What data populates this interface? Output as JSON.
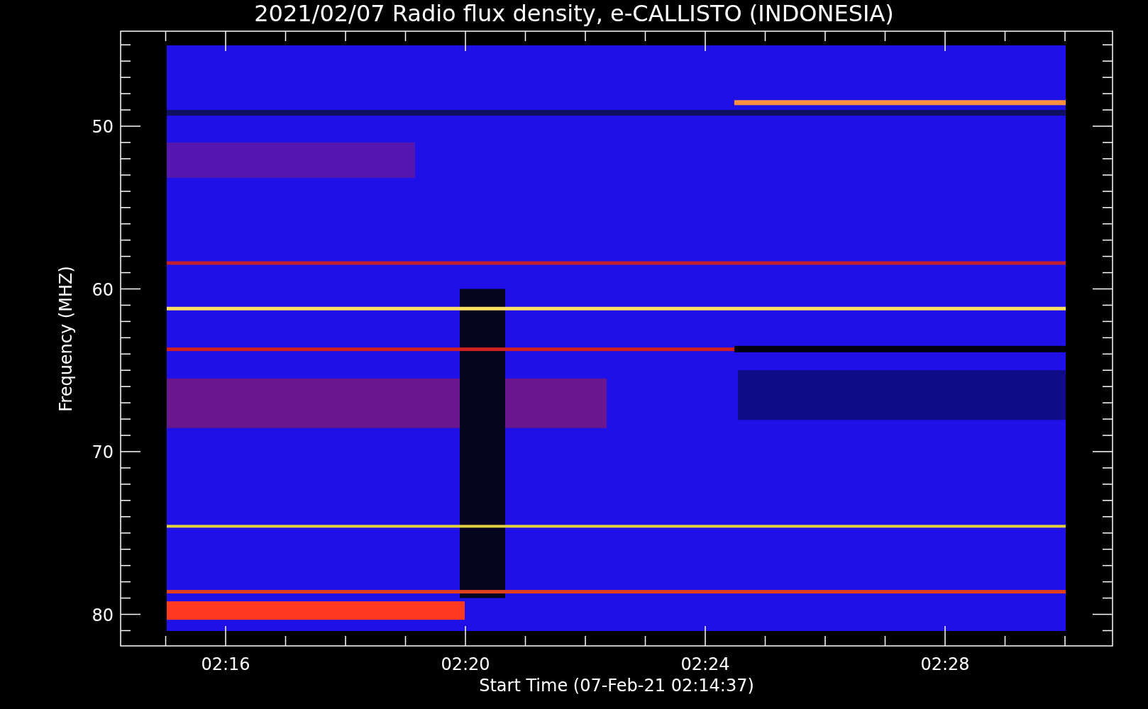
{
  "title": "2021/02/07  Radio flux density, e-CALLISTO (INDONESIA)",
  "y_axis": {
    "label": "Frequency (MHZ)",
    "ticks": [
      "50",
      "60",
      "70",
      "80"
    ]
  },
  "x_axis": {
    "label": "Start Time (07-Feb-21 02:14:37)",
    "ticks": [
      "02:16",
      "02:20",
      "02:24",
      "02:28"
    ]
  }
}
